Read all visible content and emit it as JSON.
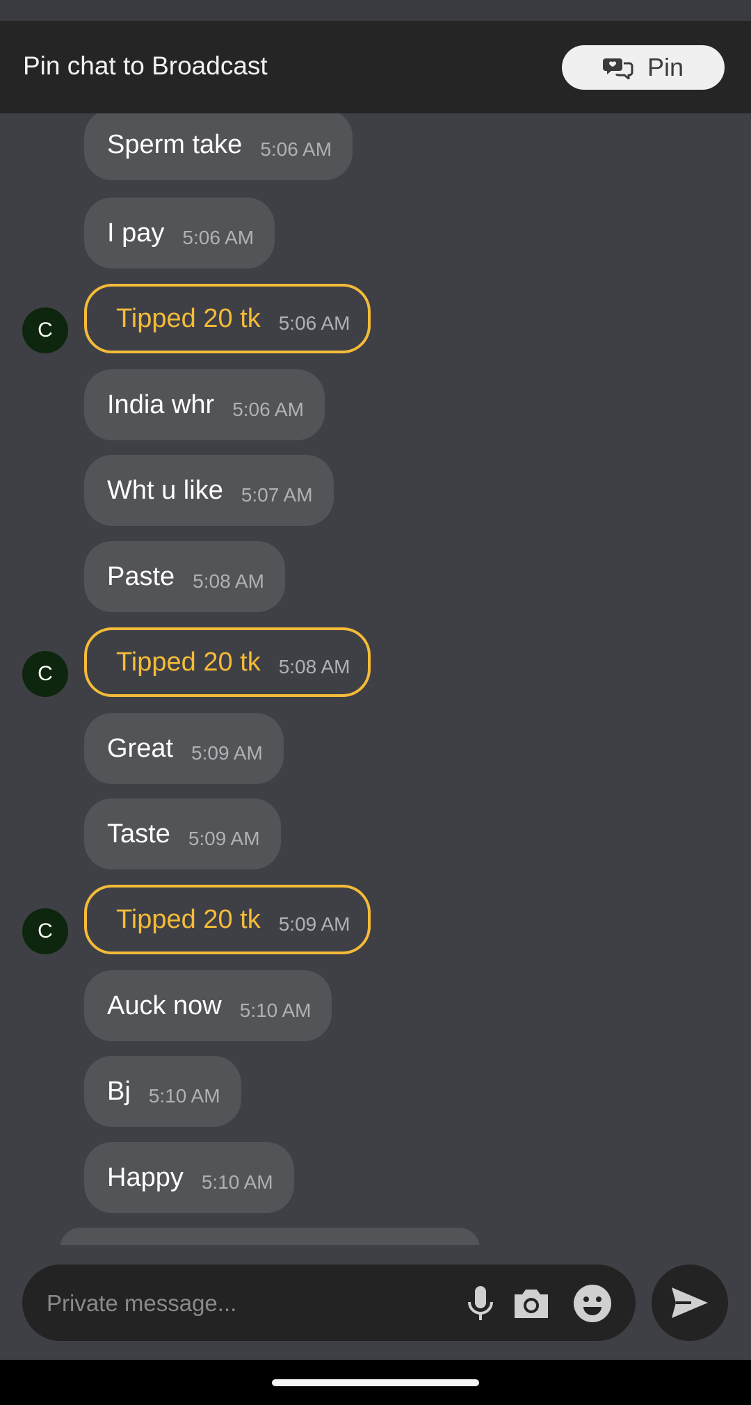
{
  "header": {
    "title": "Pin chat to Broadcast",
    "pin_label": "Pin"
  },
  "messages": [
    {
      "type": "text",
      "text": "Sperm take",
      "time": "5:06 AM"
    },
    {
      "type": "text",
      "text": "I pay",
      "time": "5:06 AM"
    },
    {
      "type": "tip",
      "text": "Tipped 20 tk",
      "time": "5:06 AM",
      "avatar": "C"
    },
    {
      "type": "text",
      "text": "India whr",
      "time": "5:06 AM"
    },
    {
      "type": "text",
      "text": "Wht u like",
      "time": "5:07 AM"
    },
    {
      "type": "text",
      "text": "Paste",
      "time": "5:08 AM"
    },
    {
      "type": "tip",
      "text": "Tipped 20 tk",
      "time": "5:08 AM",
      "avatar": "C"
    },
    {
      "type": "text",
      "text": "Great",
      "time": "5:09 AM"
    },
    {
      "type": "text",
      "text": "Taste",
      "time": "5:09 AM"
    },
    {
      "type": "tip",
      "text": "Tipped 20 tk",
      "time": "5:09 AM",
      "avatar": "C"
    },
    {
      "type": "text",
      "text": "Auck now",
      "time": "5:10 AM"
    },
    {
      "type": "text",
      "text": "Bj",
      "time": "5:10 AM"
    },
    {
      "type": "text",
      "text": "Happy",
      "time": "5:10 AM"
    }
  ],
  "composer": {
    "placeholder": "Private message...",
    "icons": [
      "microphone-icon",
      "camera-icon",
      "emoji-icon",
      "send-icon"
    ]
  },
  "colors": {
    "background": "#3f4045",
    "header": "#252525",
    "bubble": "#535458",
    "tip_accent": "#f5bb38",
    "avatar": "#0d260d"
  }
}
